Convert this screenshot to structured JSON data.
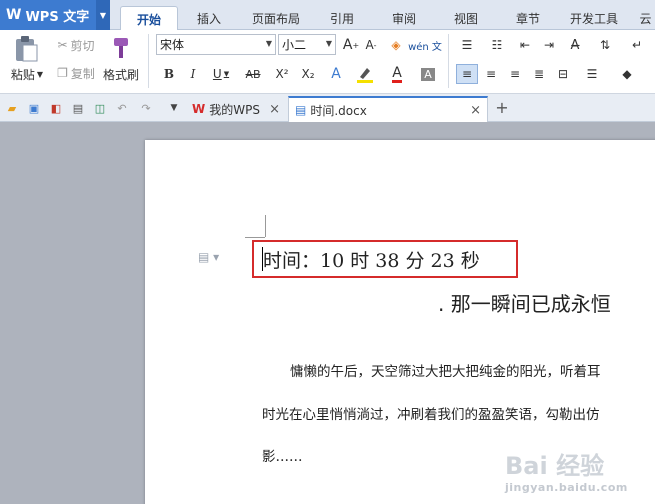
{
  "app": {
    "name": "WPS 文字",
    "logo": "W"
  },
  "ribbon_tabs": [
    {
      "label": "开始"
    },
    {
      "label": "插入"
    },
    {
      "label": "页面布局"
    },
    {
      "label": "引用"
    },
    {
      "label": "审阅"
    },
    {
      "label": "视图"
    },
    {
      "label": "章节"
    },
    {
      "label": "开发工具"
    },
    {
      "label": "云"
    }
  ],
  "ribbon": {
    "paste_label": "粘贴",
    "cut_label": "剪切",
    "copy_label": "复制",
    "format_painter_label": "格式刷",
    "font_name": "宋体",
    "font_size": "小二",
    "bold": "B",
    "italic": "I",
    "underline": "U",
    "strike": "AB",
    "superscript": "X²",
    "subscript": "X₂",
    "grow_font": "A",
    "shrink_font": "A",
    "wen": "wén 文"
  },
  "doc_tabs": [
    {
      "label": "我的WPS"
    },
    {
      "label": "时间.docx"
    }
  ],
  "document": {
    "time_line": "时间：10 时 38 分 23 秒",
    "subtitle": ". 那一瞬间已成永恒",
    "lines": [
      "慵懒的午后，天空筛过大把大把纯金的阳光，听着耳",
      "时光在心里悄悄淌过，冲刷着我们的盈盈笑语，勾勒出仿",
      "影……"
    ]
  },
  "watermark": {
    "main": "Bai 经验",
    "url": "jingyan.baidu.com"
  }
}
